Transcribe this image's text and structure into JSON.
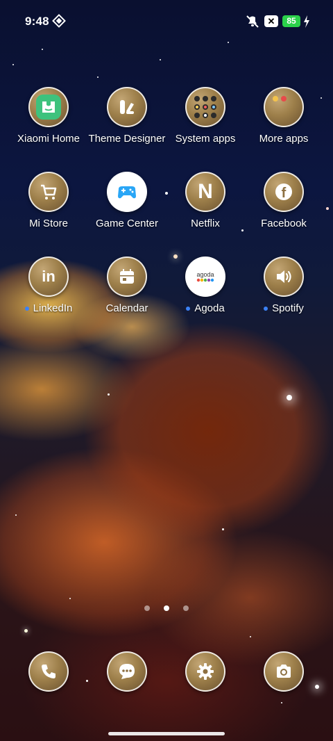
{
  "status_bar": {
    "time": "9:48",
    "battery": "85",
    "x_badge": "✕"
  },
  "apps": {
    "row1": [
      {
        "label": "Xiaomi Home",
        "icon": "xiaomi-home-icon"
      },
      {
        "label": "Theme Designer",
        "icon": "theme-designer-icon"
      },
      {
        "label": "System apps",
        "icon": "folder-icon"
      },
      {
        "label": "More apps",
        "icon": "folder-icon"
      }
    ],
    "row2": [
      {
        "label": "Mi Store",
        "icon": "cart-icon"
      },
      {
        "label": "Game Center",
        "icon": "gamepad-icon"
      },
      {
        "label": "Netflix",
        "icon": "netflix-icon"
      },
      {
        "label": "Facebook",
        "icon": "facebook-icon"
      }
    ],
    "row3": [
      {
        "label": "LinkedIn",
        "icon": "linkedin-icon",
        "new_dot": true
      },
      {
        "label": "Calendar",
        "icon": "calendar-icon"
      },
      {
        "label": "Agoda",
        "icon": "agoda-icon",
        "new_dot": true,
        "icon_text": "agoda"
      },
      {
        "label": "Spotify",
        "icon": "spotify-icon",
        "new_dot": true
      }
    ]
  },
  "netflix_glyph": "N",
  "linkedin_glyph": "in",
  "facebook_glyph": "f",
  "page_indicator": {
    "pages": 3,
    "active": 2
  },
  "dock": [
    {
      "name": "phone",
      "icon": "phone-icon"
    },
    {
      "name": "messages",
      "icon": "message-icon"
    },
    {
      "name": "settings",
      "icon": "gear-icon"
    },
    {
      "name": "camera",
      "icon": "camera-icon"
    }
  ],
  "colors": {
    "new_dot": "#3b82f6",
    "battery": "#2bd14a"
  }
}
